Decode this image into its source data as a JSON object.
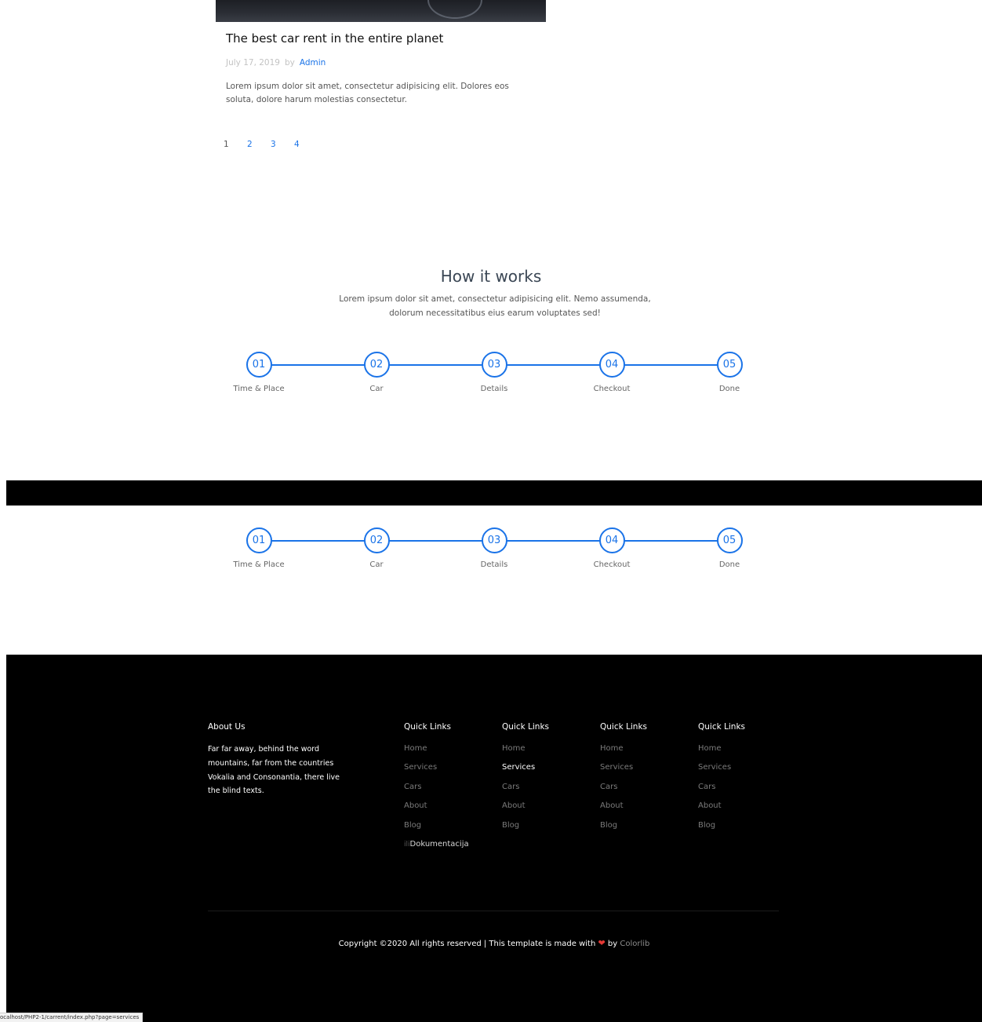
{
  "blog_post": {
    "title": "The best car rent in the entire planet",
    "date": "July 17, 2019",
    "by_label": "by",
    "author": "Admin",
    "excerpt": "Lorem ipsum dolor sit amet, consectetur adipisicing elit. Dolores eos soluta, dolore harum molestias consectetur."
  },
  "pagination": [
    "1",
    "2",
    "3",
    "4"
  ],
  "how_it_works": {
    "title": "How it works",
    "subtitle": "Lorem ipsum dolor sit amet, consectetur adipisicing elit. Nemo assumenda, dolorum necessitatibus eius earum voluptates sed!",
    "steps": [
      {
        "number": "01",
        "label": "Time & Place"
      },
      {
        "number": "02",
        "label": "Car"
      },
      {
        "number": "03",
        "label": "Details"
      },
      {
        "number": "04",
        "label": "Checkout"
      },
      {
        "number": "05",
        "label": "Done"
      }
    ]
  },
  "footer": {
    "about_title": "About Us",
    "about_text": "Far far away, behind the word mountains, far from the countries Vokalia and Consonantia, there live the blind texts.",
    "columns": [
      {
        "title": "Quick Links",
        "links": [
          "Home",
          "Services",
          "Cars",
          "About",
          "Blog"
        ],
        "doc_prefix": "ili",
        "doc_link": "Dokumentacija"
      },
      {
        "title": "Quick Links",
        "links": [
          "Home",
          "Services",
          "Cars",
          "About",
          "Blog"
        ]
      },
      {
        "title": "Quick Links",
        "links": [
          "Home",
          "Services",
          "Cars",
          "About",
          "Blog"
        ]
      },
      {
        "title": "Quick Links",
        "links": [
          "Home",
          "Services",
          "Cars",
          "About",
          "Blog"
        ]
      }
    ],
    "copyright_prefix": "Copyright ©2020 All rights reserved | This template is made with",
    "copyright_by": "by",
    "copyright_brand": "Colorlib"
  },
  "status_bar_url": "ocalhost/PHP2-1/carrent/index.php?page=services",
  "colors": {
    "accent": "#1a73e8",
    "footer_bg": "#000000",
    "heart": "#e53935"
  },
  "icons": {
    "heart": "heart-icon"
  }
}
